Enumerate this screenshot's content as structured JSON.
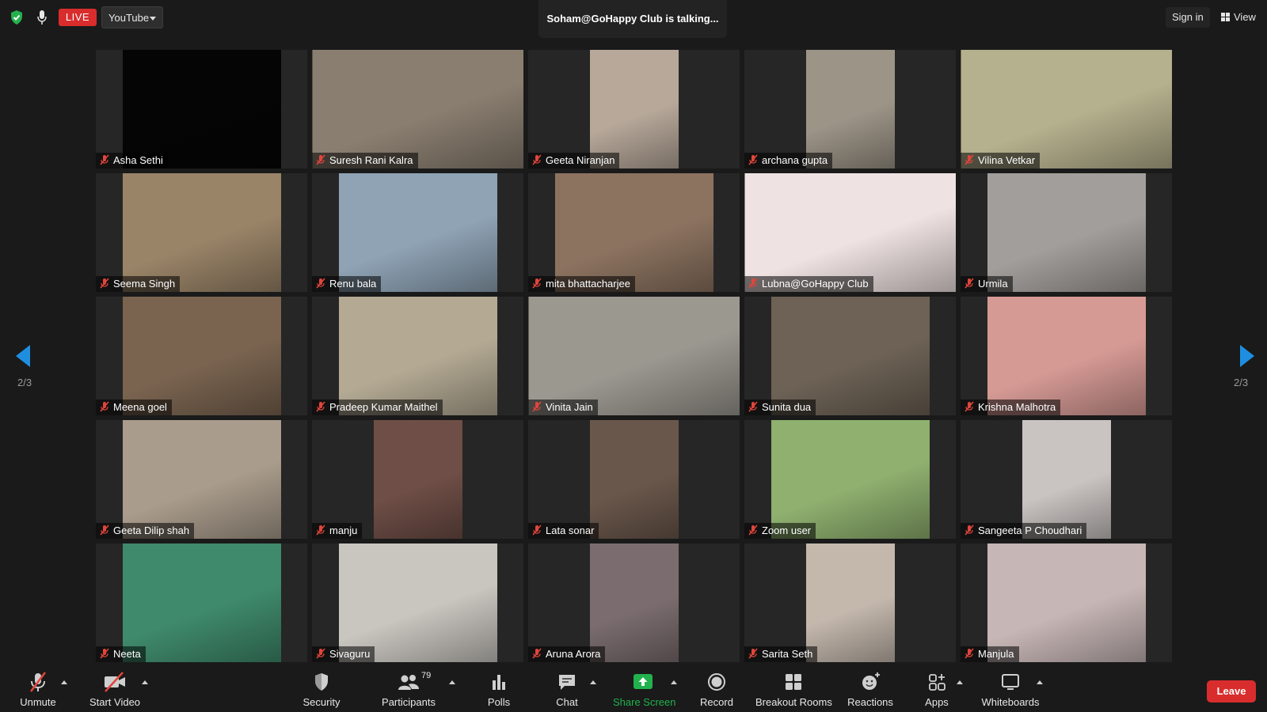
{
  "top": {
    "live_label": "LIVE",
    "stream_target": "YouTube",
    "talking_text": "Soham@GoHappy Club is talking...",
    "sign_in": "Sign in",
    "view": "View"
  },
  "participants": [
    {
      "name": "Asha Sethi",
      "bg": "#050505"
    },
    {
      "name": "Suresh  Rani Kalra",
      "bg": "#8a7e70"
    },
    {
      "name": "Geeta Niranjan",
      "bg": "#b7a89a"
    },
    {
      "name": "archana gupta",
      "bg": "#9c9487"
    },
    {
      "name": "Vilina Vetkar",
      "bg": "#b5b08d"
    },
    {
      "name": "Seema Singh",
      "bg": "#9a8468"
    },
    {
      "name": "Renu bala",
      "bg": "#8fa3b5"
    },
    {
      "name": "mita bhattacharjee",
      "bg": "#8c7360"
    },
    {
      "name": "Lubna@GoHappy Club",
      "bg": "#efe2e2"
    },
    {
      "name": "Urmila",
      "bg": "#a29e9b"
    },
    {
      "name": "Meena goel",
      "bg": "#7a6450"
    },
    {
      "name": "Pradeep Kumar Maithel",
      "bg": "#b4aa94"
    },
    {
      "name": "Vinita Jain",
      "bg": "#9b9890"
    },
    {
      "name": "Sunita dua",
      "bg": "#6d6255"
    },
    {
      "name": "Krishna Malhotra",
      "bg": "#d69a95"
    },
    {
      "name": "Geeta Dilip shah",
      "bg": "#a99c8c"
    },
    {
      "name": "manju",
      "bg": "#6e4e46"
    },
    {
      "name": "Lata sonar",
      "bg": "#6a574b"
    },
    {
      "name": "Zoom user",
      "bg": "#8fb06f"
    },
    {
      "name": "Sangeeta P Choudhari",
      "bg": "#c9c3c1"
    },
    {
      "name": "Neeta",
      "bg": "#3f8a6c"
    },
    {
      "name": "Sivaguru",
      "bg": "#c9c6c0"
    },
    {
      "name": "Aruna Arora",
      "bg": "#7b6d6f"
    },
    {
      "name": "Sarita Seth",
      "bg": "#c4b8ad"
    },
    {
      "name": "Manjula",
      "bg": "#c7b6b6"
    }
  ],
  "pagination": {
    "left": "2/3",
    "right": "2/3"
  },
  "toolbar": {
    "unmute": "Unmute",
    "start_video": "Start Video",
    "security": "Security",
    "participants": "Participants",
    "participants_count": "79",
    "polls": "Polls",
    "chat": "Chat",
    "share_screen": "Share Screen",
    "record": "Record",
    "breakout_rooms": "Breakout Rooms",
    "reactions": "Reactions",
    "apps": "Apps",
    "whiteboards": "Whiteboards",
    "leave": "Leave"
  },
  "colors": {
    "live_red": "#d92d2d",
    "share_green": "#21b24e",
    "arrow_blue": "#1e8fe0",
    "muted_red": "#e0453b"
  }
}
